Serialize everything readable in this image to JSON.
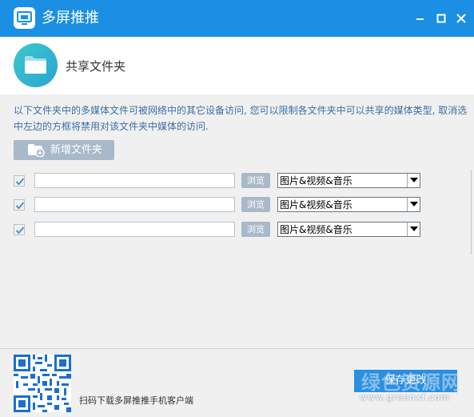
{
  "window": {
    "title": "多屏推推",
    "icons": {
      "app": "cast-screen-icon",
      "minimize": "minimize-icon",
      "maximize": "maximize-icon",
      "close": "close-icon"
    },
    "accent_color": "#1a8fe3"
  },
  "header": {
    "title": "共享文件夹",
    "icon": "folder-icon"
  },
  "description": "以下文件夹中的多媒体文件可被网络中的其它设备访问, 您可以限制各文件夹中可以共享的媒体类型, 取消选中左边的方框将禁用对该文件夹中媒体的访问.",
  "toolbar": {
    "add_folder_label": "新增文件夹",
    "add_folder_icon": "add-folder-icon"
  },
  "folders": [
    {
      "checked": true,
      "path": "",
      "browse_label": "浏览",
      "media_type": "图片&视频&音乐"
    },
    {
      "checked": true,
      "path": "",
      "browse_label": "浏览",
      "media_type": "图片&视频&音乐"
    },
    {
      "checked": true,
      "path": "",
      "browse_label": "浏览",
      "media_type": "图片&视频&音乐"
    }
  ],
  "footer": {
    "qr_caption": "扫码下载多屏推推手机客户端",
    "save_label": "保存更改"
  },
  "watermark": {
    "text": "绿色资源网",
    "url": "www.greenxf.com"
  }
}
